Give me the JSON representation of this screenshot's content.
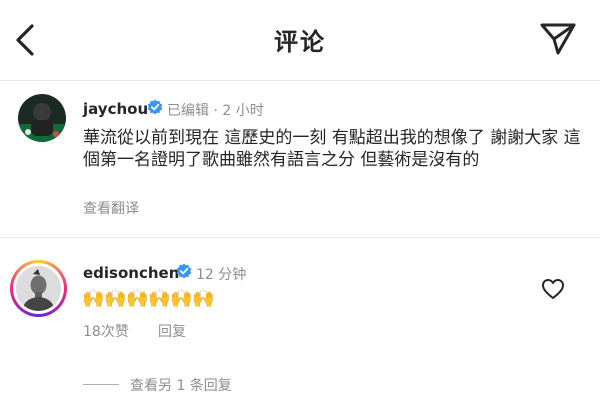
{
  "header": {
    "title": "评论",
    "back_icon": "chevron-left-icon",
    "share_icon": "paper-plane-icon"
  },
  "caption": {
    "username": "jaychou",
    "edited": "已编辑",
    "separator": "·",
    "time": "2 小时",
    "text": "華流從以前到現在 這歷史的一刻 有點超出我的想像了 謝謝大家 這個第一名證明了歌曲雖然有語言之分 但藝術是沒有的",
    "translate": "查看翻译"
  },
  "comment": {
    "username": "edisonchen",
    "time": "12 分钟",
    "emojis": [
      "🙌",
      "🙌",
      "🙌",
      "🙌",
      "🙌",
      "🙌"
    ],
    "likes": "18次赞",
    "reply": "回复",
    "more_replies": "查看另 1 条回复"
  },
  "colors": {
    "verified": "#3897f0",
    "muted": "#8e8e8e",
    "text": "#262626"
  }
}
